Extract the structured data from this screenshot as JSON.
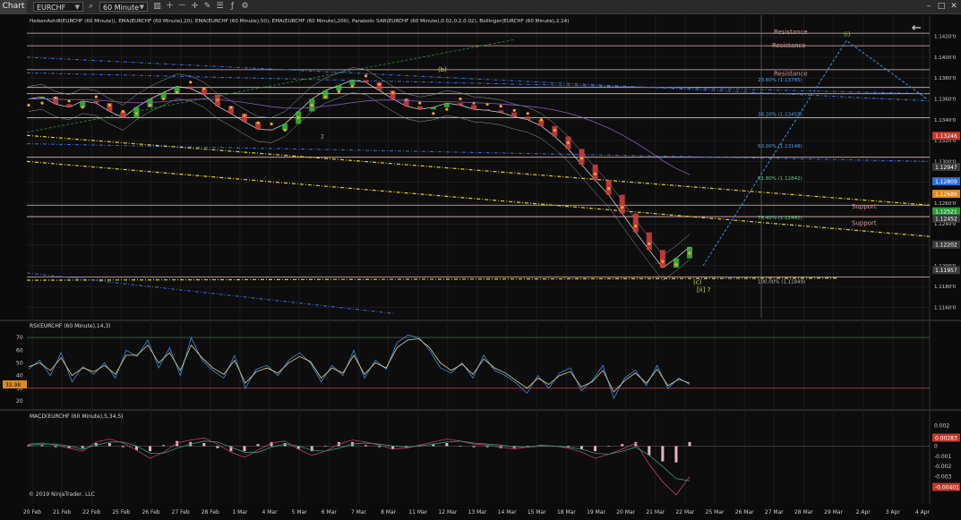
{
  "toolbar": {
    "chart_label": "Chart",
    "instrument": "EURCHF",
    "interval": "60 Minute"
  },
  "copyright": "© 2019 NinjaTrader, LLC",
  "chart_data": [
    {
      "type": "line",
      "panel": "price",
      "title": "HeikenAshi8(EURCHF (60 Minute)), EMA(EURCHF (60 Minute),20), EMA(EURCHF (60 Minute),50), EMA(EURCHF (60 Minute),200), Parabolic SAR(EURCHF (60 Minute),0.02,0.2,0.02), Bollinger(EURCHF (60 Minute),2,14)",
      "yticks": [
        "1.1420'0",
        "1.1400'0",
        "1.1380'0",
        "1.1360'0",
        "1.1340'0",
        "1.1320'0",
        "1.1300'0",
        "1.1280'0",
        "1.1260'0",
        "1.1240'0",
        "1.1220'0",
        "1.1200'0",
        "1.1180'0",
        "1.1160'0"
      ],
      "ylim": [
        1.115,
        1.143
      ],
      "price_badges": [
        {
          "label": "1.13246",
          "value": 1.13246,
          "color": "#c0392b"
        },
        {
          "label": "1.12947",
          "value": 1.12947,
          "color": "#3a3a3a"
        },
        {
          "label": "1.12809",
          "value": 1.12809,
          "color": "#2e6fd6"
        },
        {
          "label": "1.12689",
          "value": 1.12689,
          "color": "#e08a1e"
        },
        {
          "label": "1.12521",
          "value": 1.12521,
          "color": "#2d9a3a"
        },
        {
          "label": "1.12452",
          "value": 1.12452,
          "color": "#3a3a3a"
        },
        {
          "label": "1.12202",
          "value": 1.12202,
          "color": "#3a3a3a"
        },
        {
          "label": "1.11957",
          "value": 1.11957,
          "color": "#3a3a3a"
        }
      ],
      "horizontal_lines": [
        1.1423,
        1.1411,
        1.1388,
        1.1371,
        1.1365,
        1.1342,
        1.1304,
        1.1258,
        1.1247,
        1.1189
      ],
      "resistance_labels": [
        "Resistance",
        "Resistance",
        "Resistance"
      ],
      "support_labels": [
        "Support",
        "Support"
      ],
      "fib_levels": [
        {
          "label": "23.60% (1.13785)",
          "value": 1.13785
        },
        {
          "label": "38.20% (1.13455)",
          "value": 1.13455
        },
        {
          "label": "50.00% (1.13148)",
          "value": 1.13148
        },
        {
          "label": "61.80% (1.12842)",
          "value": 1.12842
        },
        {
          "label": "76.40% (1.12462)",
          "value": 1.12462
        },
        {
          "label": "100.00% (1.11849)",
          "value": 1.11849
        }
      ],
      "wave_labels": [
        "(b)",
        "(c)",
        "[ii] ?",
        "(i)",
        "2"
      ],
      "series": [
        {
          "name": "",
          "color": "#e6e6e6",
          "values": [
            1.136,
            1.1362,
            1.1355,
            1.1352,
            1.1358,
            1.1356,
            1.1348,
            1.1342,
            1.1352,
            1.136,
            1.1366,
            1.1372,
            1.137,
            1.1364,
            1.1353,
            1.1346,
            1.1338,
            1.1331,
            1.133,
            1.1336,
            1.1348,
            1.136,
            1.1368,
            1.1373,
            1.1378,
            1.1376,
            1.1368,
            1.136,
            1.1353,
            1.135,
            1.1352,
            1.1356,
            1.1354,
            1.135,
            1.1349,
            1.1347,
            1.1343,
            1.134,
            1.1334,
            1.1324,
            1.1312,
            1.1297,
            1.1282,
            1.1268,
            1.125,
            1.1232,
            1.1215,
            1.1198,
            1.1207,
            1.1218
          ]
        }
      ]
    },
    {
      "type": "line",
      "panel": "rsi",
      "title": "RSI(EURCHF (60 Minute),14,3)",
      "yticks": [
        "70",
        "60",
        "50",
        "40",
        "30",
        "20"
      ],
      "ylim": [
        15,
        75
      ],
      "current_label": "32.98",
      "current_value": 32.98,
      "series": [
        {
          "name": "",
          "color": "#3d8ee6",
          "values": [
            45,
            52,
            40,
            58,
            35,
            47,
            41,
            50,
            38,
            60,
            55,
            68,
            46,
            62,
            40,
            70,
            52,
            44,
            38,
            56,
            30,
            45,
            48,
            40,
            52,
            58,
            50,
            35,
            48,
            40,
            60,
            38,
            52,
            45,
            66,
            72,
            70,
            60,
            46,
            42,
            50,
            38,
            56,
            44,
            40,
            34,
            26,
            40,
            30,
            42,
            46,
            28,
            36,
            48,
            22,
            38,
            44,
            32,
            48,
            30,
            38,
            33
          ]
        },
        {
          "name": "",
          "color": "#e6d08a",
          "values": [
            47,
            50,
            44,
            54,
            40,
            46,
            43,
            48,
            41,
            56,
            56,
            64,
            50,
            58,
            44,
            64,
            54,
            46,
            41,
            52,
            34,
            43,
            46,
            42,
            50,
            55,
            51,
            38,
            46,
            42,
            56,
            41,
            50,
            46,
            62,
            68,
            69,
            62,
            50,
            44,
            49,
            41,
            53,
            46,
            42,
            36,
            30,
            38,
            33,
            40,
            43,
            31,
            35,
            44,
            27,
            36,
            42,
            34,
            45,
            32,
            37,
            34
          ]
        }
      ]
    },
    {
      "type": "bar",
      "panel": "macd",
      "title": "MACD(EURCHF (60 Minute),5,34,5)",
      "yticks": [
        "0.002",
        "0.001",
        "0",
        "-0.001",
        "-0.002",
        "-0.003",
        "-0.004"
      ],
      "ylim": [
        -0.0055,
        0.0025
      ],
      "badges": [
        {
          "label": "0.00283",
          "value": 0.00083,
          "color": "#c0392b"
        },
        {
          "label": "-0.00401",
          "value": -0.00401,
          "color": "#c0392b"
        }
      ],
      "series": [
        {
          "name": "",
          "color": "#c23a6e",
          "values": [
            0.0002,
            0.0003,
            0.0001,
            -0.0002,
            -0.0005,
            0.0004,
            0.0007,
            0.0003,
            -0.0004,
            -0.0012,
            -0.0006,
            0.0003,
            0.0006,
            0.0008,
            0.0002,
            -0.0006,
            -0.0011,
            -0.0004,
            0.0003,
            0.0005,
            -0.0003,
            -0.0009,
            -0.0005,
            0.0002,
            0.0006,
            0.0004,
            0.0001,
            -0.0003,
            -0.0002,
            0.0001,
            0.0004,
            0.0007,
            0.0005,
            0.0002,
            0.0001,
            -0.0001,
            -0.0003,
            -0.0001,
            0.0001,
            0.0,
            -0.0002,
            -0.0006,
            -0.0012,
            -0.0008,
            -0.0003,
            0.0003,
            -0.0018,
            -0.0035,
            -0.0048,
            -0.003
          ]
        },
        {
          "name": "",
          "color": "#2e9d7a",
          "values": [
            0.0001,
            0.0002,
            0.0002,
            0.0,
            -0.0003,
            0.0001,
            0.0004,
            0.0004,
            0.0,
            -0.0007,
            -0.0007,
            -0.0002,
            0.0002,
            0.0005,
            0.0004,
            -0.0001,
            -0.0006,
            -0.0006,
            -0.0001,
            0.0002,
            0.0,
            -0.0004,
            -0.0005,
            -0.0002,
            0.0002,
            0.0003,
            0.0002,
            0.0,
            -0.0001,
            0.0,
            0.0002,
            0.0004,
            0.0005,
            0.0003,
            0.0002,
            0.0001,
            -0.0001,
            -0.0001,
            0.0,
            0.0,
            -0.0001,
            -0.0003,
            -0.0007,
            -0.0008,
            -0.0005,
            -0.0001,
            -0.0009,
            -0.002,
            -0.0032,
            -0.0034
          ]
        }
      ]
    }
  ],
  "xaxis": {
    "tick_labels": [
      "20 Feb",
      "21 Feb",
      "22 Feb",
      "25 Feb",
      "26 Feb",
      "27 Feb",
      "28 Feb",
      "1 Mar",
      "4 Mar",
      "5 Mar",
      "6 Mar",
      "7 Mar",
      "8 Mar",
      "11 Mar",
      "12 Mar",
      "13 Mar",
      "14 Mar",
      "15 Mar",
      "18 Mar",
      "19 Mar",
      "20 Mar",
      "21 Mar",
      "22 Mar",
      "25 Mar",
      "26 Mar",
      "27 Mar",
      "28 Mar",
      "29 Mar",
      "2 Apr",
      "3 Apr",
      "4 Apr"
    ]
  }
}
